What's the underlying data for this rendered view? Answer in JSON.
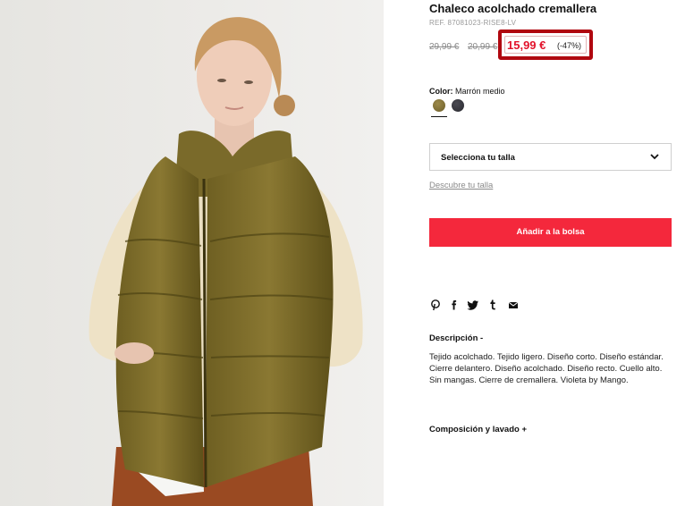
{
  "product": {
    "title": "Chaleco acolchado cremallera",
    "ref": "REF. 87081023-RISE8-LV",
    "old_price_1": "29,99 €",
    "old_price_2": "20,99 €",
    "price": "15,99 €",
    "discount": "(-47%)",
    "color_label": "Color:",
    "color_value": "Marrón medio",
    "swatches": [
      {
        "name": "Marrón medio",
        "color": "#8a7a3c"
      },
      {
        "name": "Negro",
        "color": "#34343a"
      }
    ]
  },
  "size": {
    "placeholder": "Selecciona tu talla",
    "guide_link": "Descubre tu talla"
  },
  "actions": {
    "add_to_bag": "Añadir a la bolsa"
  },
  "share_icons": [
    "pinterest-icon",
    "facebook-icon",
    "twitter-icon",
    "tumblr-icon",
    "email-icon"
  ],
  "description": {
    "title": "Descripción -",
    "text": "Tejido acolchado. Tejido ligero. Diseño corto. Diseño estándar. Cierre delantero. Diseño acolchado. Diseño recto. Cuello alto. Sin mangas. Cierre de cremallera. Violeta by Mango."
  },
  "composition": {
    "title": "Composición y lavado +"
  },
  "colors": {
    "accent": "#f4283c",
    "price_red": "#e2122b",
    "highlight_border": "#b0070f"
  }
}
